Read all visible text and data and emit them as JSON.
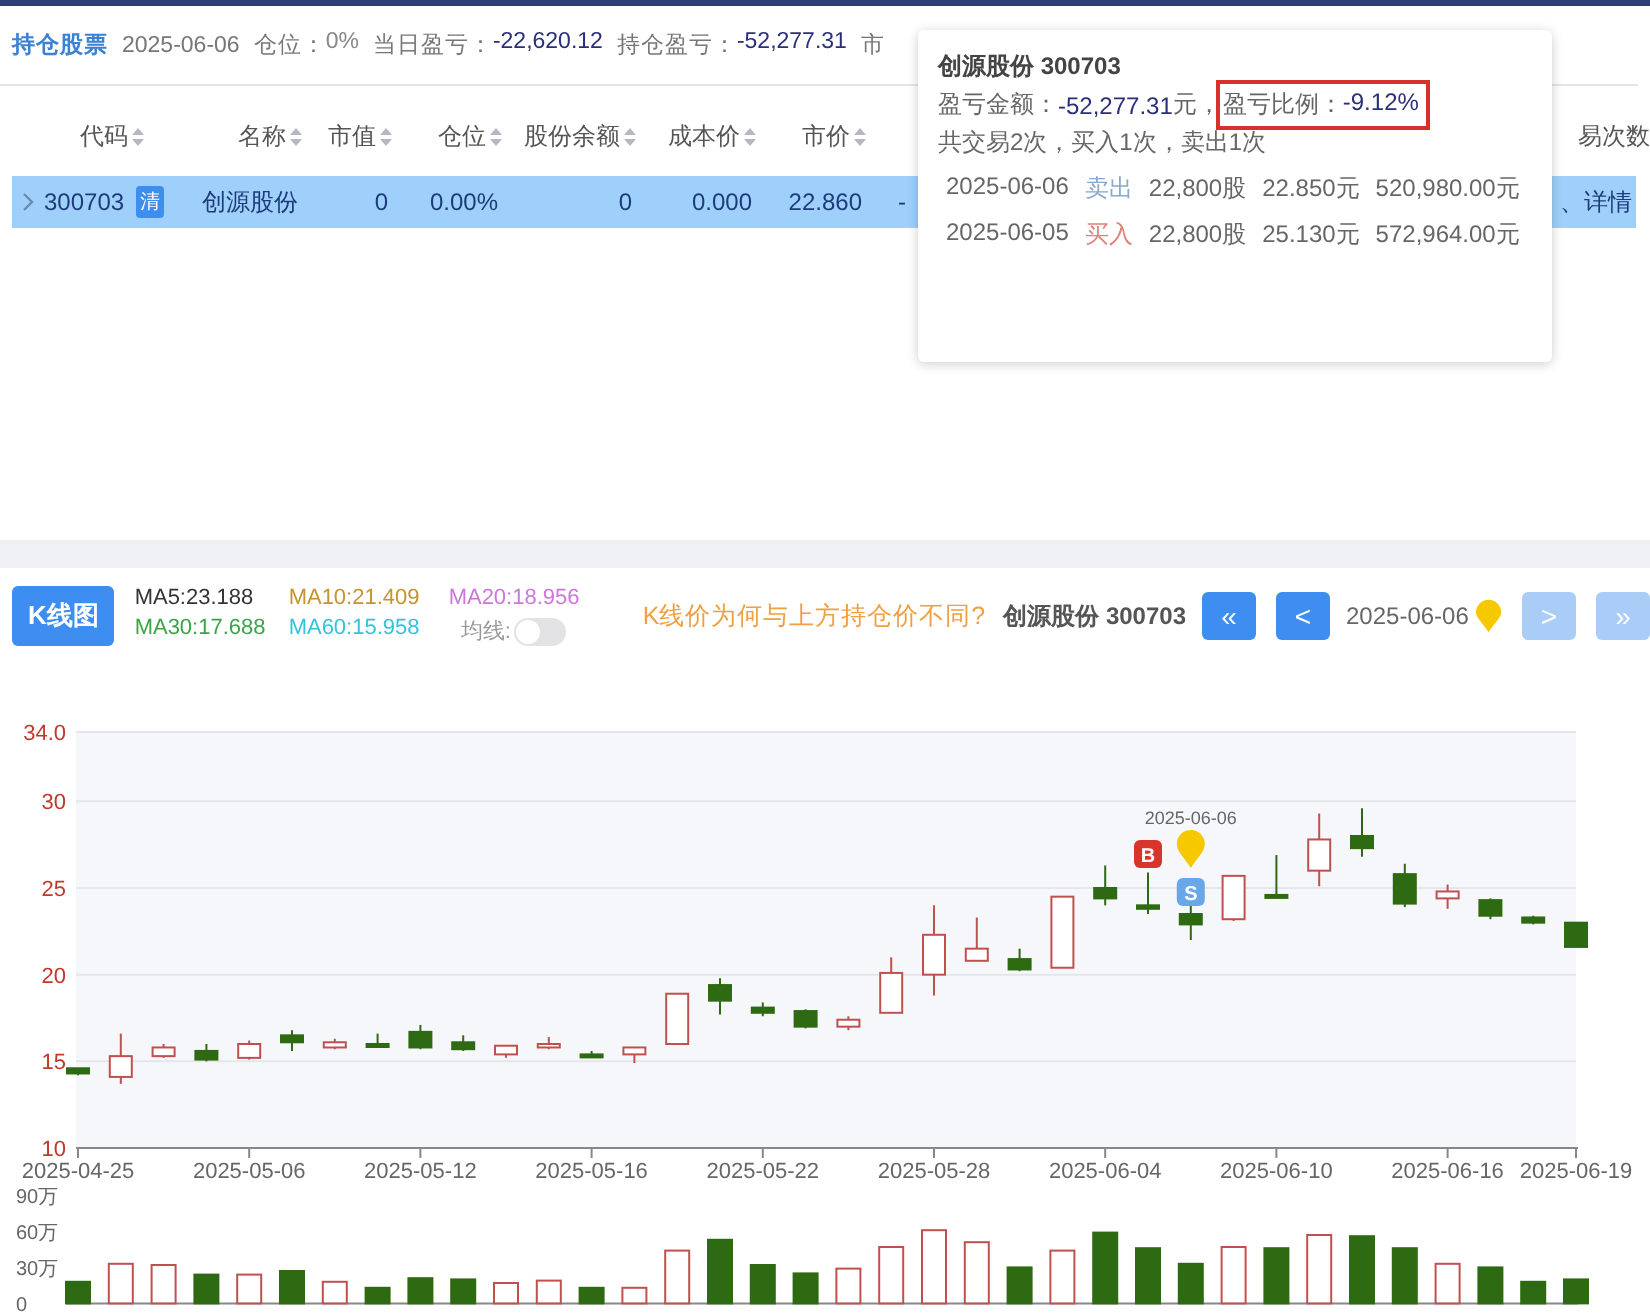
{
  "summary": {
    "title": "持仓股票",
    "date": "2025-06-06",
    "items": [
      {
        "label": "仓位：",
        "value": "0%",
        "kind": "plain"
      },
      {
        "label": "当日盈亏：",
        "value": "-22,620.12",
        "kind": "amount"
      },
      {
        "label": "持仓盈亏：",
        "value": "-52,277.31",
        "kind": "amount"
      },
      {
        "label": "市"
      }
    ]
  },
  "table": {
    "columns": [
      {
        "label": "代码",
        "sort_icon": true
      },
      {
        "label": "名称",
        "sort_icon": true
      },
      {
        "label": "市值",
        "sort_icon": true
      },
      {
        "label": "仓位",
        "sort_icon": true
      },
      {
        "label": "股份余额",
        "sort_icon": true
      },
      {
        "label": "成本价",
        "sort_icon": true
      },
      {
        "label": "市价",
        "sort_icon": true
      }
    ],
    "last_column": {
      "label": "易次数"
    },
    "rows": [
      {
        "selected": true,
        "expanded": false,
        "badge": "清",
        "cells": [
          "300703",
          "创源股份",
          "0",
          "0.00%",
          "0",
          "0.000",
          "22.860",
          "-"
        ],
        "action": "、详情"
      }
    ]
  },
  "tooltip": {
    "title": "创源股份 300703",
    "pnl": {
      "label": "盈亏金额：",
      "value": "-52,277.31",
      "unit": "元，"
    },
    "ratio": {
      "label": "盈亏比例：",
      "value": "-9.12%",
      "highlighted": true
    },
    "summary": "共交易2次，买入1次，卖出1次",
    "trades": [
      {
        "date": "2025-06-06",
        "action": "卖出",
        "kind": "sell",
        "shares": "22,800股",
        "price": "22.850元",
        "amount": "520,980.00元"
      },
      {
        "date": "2025-06-05",
        "action": "买入",
        "kind": "buy",
        "shares": "22,800股",
        "price": "25.130元",
        "amount": "572,964.00元"
      }
    ]
  },
  "kline": {
    "tab": {
      "label": "K线图",
      "selected": true
    },
    "ma": [
      {
        "label": "MA5:23.188",
        "color": "#333333"
      },
      {
        "label": "MA10:21.409",
        "color": "#c8932e"
      },
      {
        "label": "MA20:18.956",
        "color": "#cc77dd"
      },
      {
        "label": "MA30:17.688",
        "color": "#3aa545"
      },
      {
        "label": "MA60:15.958",
        "color": "#33c3dd"
      }
    ],
    "ma_toggle": {
      "label": "均线:",
      "on": false
    },
    "help_link": "K线价为何与上方持仓价不同?",
    "stock": "创源股份 300703",
    "nav_before": [
      {
        "label": "«",
        "disabled": false
      },
      {
        "label": "<",
        "disabled": false
      }
    ],
    "date": "2025-06-06",
    "nav_after": [
      {
        "label": ">",
        "disabled": true
      },
      {
        "label": "»",
        "disabled": true
      }
    ],
    "price_chart": {
      "chart_data": {
        "type": "candlestick",
        "grid": true,
        "categories": [
          "2025-04-25",
          null,
          null,
          null,
          "2025-05-06",
          null,
          null,
          null,
          "2025-05-12",
          null,
          null,
          null,
          "2025-05-16",
          null,
          null,
          null,
          "2025-05-22",
          null,
          null,
          null,
          "2025-05-28",
          null,
          null,
          null,
          "2025-06-04",
          null,
          null,
          null,
          "2025-06-10",
          null,
          null,
          null,
          "2025-06-16",
          null,
          null,
          "2025-06-19"
        ],
        "ohlc": [
          [
            14.6,
            14.6,
            14.2,
            14.3
          ],
          [
            14.1,
            16.6,
            13.7,
            15.3
          ],
          [
            15.3,
            16.0,
            15.2,
            15.8
          ],
          [
            15.6,
            16.0,
            15.0,
            15.1
          ],
          [
            15.2,
            16.2,
            15.1,
            16.0
          ],
          [
            16.5,
            16.8,
            15.6,
            16.1
          ],
          [
            15.8,
            16.3,
            15.7,
            16.1
          ],
          [
            16.0,
            16.6,
            15.8,
            15.9
          ],
          [
            16.7,
            17.1,
            15.7,
            15.8
          ],
          [
            16.1,
            16.5,
            15.6,
            15.7
          ],
          [
            15.4,
            15.9,
            15.2,
            15.9
          ],
          [
            15.8,
            16.4,
            15.7,
            16.0
          ],
          [
            15.4,
            15.6,
            15.2,
            15.3
          ],
          [
            15.4,
            15.8,
            14.9,
            15.8
          ],
          [
            16.0,
            18.9,
            16.0,
            18.9
          ],
          [
            19.4,
            19.8,
            17.7,
            18.5
          ],
          [
            18.1,
            18.4,
            17.6,
            17.8
          ],
          [
            17.9,
            18.0,
            16.9,
            17.0
          ],
          [
            17.0,
            17.6,
            16.8,
            17.4
          ],
          [
            17.8,
            21.0,
            17.8,
            20.1
          ],
          [
            20.0,
            24.0,
            18.8,
            22.3
          ],
          [
            20.8,
            23.3,
            20.8,
            21.5
          ],
          [
            20.9,
            21.5,
            20.2,
            20.3
          ],
          [
            20.4,
            24.5,
            20.4,
            24.5
          ],
          [
            25.0,
            26.3,
            24.0,
            24.4
          ],
          [
            24.0,
            25.9,
            23.5,
            23.8
          ],
          [
            23.5,
            24.0,
            22.0,
            22.9
          ],
          [
            23.2,
            25.7,
            23.1,
            25.7
          ],
          [
            24.6,
            26.9,
            24.5,
            24.5
          ],
          [
            26.0,
            29.3,
            25.1,
            27.8
          ],
          [
            28.0,
            29.6,
            26.8,
            27.3
          ],
          [
            25.8,
            26.4,
            23.9,
            24.1
          ],
          [
            24.4,
            25.2,
            23.8,
            24.8
          ],
          [
            24.3,
            24.4,
            23.2,
            23.4
          ],
          [
            23.3,
            23.4,
            22.9,
            23.0
          ],
          [
            23.0,
            23.0,
            21.6,
            21.6
          ]
        ],
        "ylim": [
          10,
          34
        ],
        "yticks": [
          10,
          15,
          20,
          25,
          30,
          {
            "value": 34,
            "label": "34.0"
          }
        ]
      },
      "markers": [
        {
          "label": "B",
          "kind": "buy"
        },
        {
          "label": "S",
          "kind": "sell"
        },
        {
          "label": "2025-06-06",
          "kind": "date"
        }
      ]
    },
    "volume_chart": {
      "chart_data": {
        "type": "bar",
        "values": [
          18,
          33,
          32,
          24,
          24,
          27,
          18,
          13,
          21,
          20,
          17,
          19,
          13,
          13,
          44,
          53,
          32,
          25,
          29,
          47,
          61,
          51,
          30,
          44,
          59,
          46,
          33,
          47,
          46,
          57,
          56,
          46,
          33,
          30,
          18,
          20
        ],
        "ylim": [
          0,
          90
        ],
        "yticks": [
          {
            "value": 0,
            "label": "0"
          },
          {
            "value": 30,
            "label": "30万"
          },
          {
            "value": 60,
            "label": "60万"
          },
          {
            "value": 90,
            "label": "90万"
          }
        ]
      }
    }
  }
}
